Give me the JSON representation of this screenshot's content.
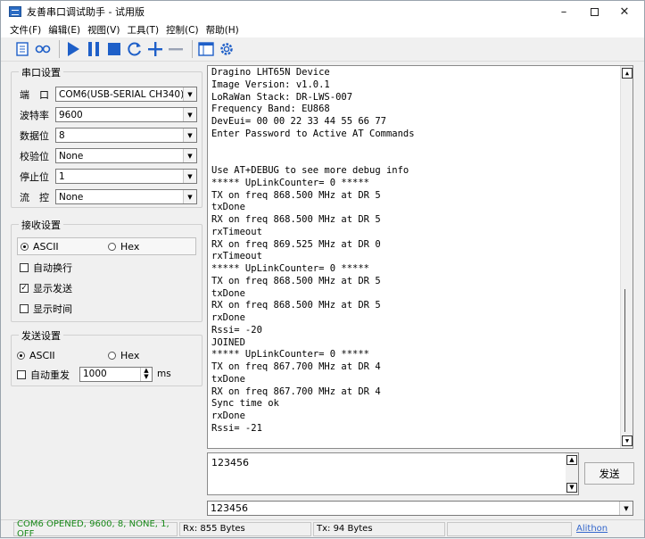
{
  "window": {
    "title": "友善串口调试助手 - 试用版"
  },
  "menu": [
    "文件(F)",
    "编辑(E)",
    "视图(V)",
    "工具(T)",
    "控制(C)",
    "帮助(H)"
  ],
  "serial_settings": {
    "title": "串口设置",
    "port": {
      "label": "端　口",
      "value": "COM6(USB-SERIAL CH340)"
    },
    "baud": {
      "label": "波特率",
      "value": "9600"
    },
    "databits": {
      "label": "数据位",
      "value": "8"
    },
    "parity": {
      "label": "校验位",
      "value": "None"
    },
    "stopbits": {
      "label": "停止位",
      "value": "1"
    },
    "flow": {
      "label": "流　控",
      "value": "None"
    }
  },
  "receive_settings": {
    "title": "接收设置",
    "ascii": "ASCII",
    "hex": "Hex",
    "auto_wrap": "自动换行",
    "show_send": "显示发送",
    "show_time": "显示时间"
  },
  "send_settings": {
    "title": "发送设置",
    "ascii": "ASCII",
    "hex": "Hex",
    "auto_resend": "自动重发",
    "interval": "1000",
    "unit": "ms"
  },
  "receive_log": "Dragino LHT65N Device\nImage Version: v1.0.1\nLoRaWan Stack: DR-LWS-007\nFrequency Band: EU868\nDevEui= 00 00 22 33 44 55 66 77\nEnter Password to Active AT Commands\n\n\nUse AT+DEBUG to see more debug info\n***** UpLinkCounter= 0 *****\nTX on freq 868.500 MHz at DR 5\ntxDone\nRX on freq 868.500 MHz at DR 5\nrxTimeout\nRX on freq 869.525 MHz at DR 0\nrxTimeout\n***** UpLinkCounter= 0 *****\nTX on freq 868.500 MHz at DR 5\ntxDone\nRX on freq 868.500 MHz at DR 5\nrxDone\nRssi= -20\nJOINED\n***** UpLinkCounter= 0 *****\nTX on freq 867.700 MHz at DR 4\ntxDone\nRX on freq 867.700 MHz at DR 4\nSync time ok\nrxDone\nRssi= -21",
  "send_text": "123456",
  "send_button": "发送",
  "history_value": "123456",
  "status": {
    "port": "COM6 OPENED, 9600, 8, NONE, 1, OFF",
    "rx": "Rx: 855 Bytes",
    "tx": "Tx: 94 Bytes",
    "brand": "Alithon"
  },
  "colors": {
    "status_green": "#1a8a1a",
    "toolbar_blue": "#1e5fc8",
    "link_blue": "#3366cc"
  }
}
